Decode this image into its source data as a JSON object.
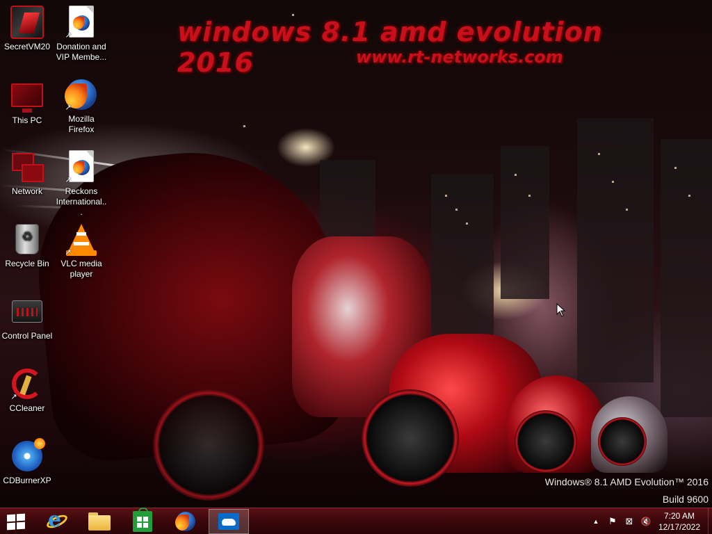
{
  "wallpaper": {
    "title": "windows 8.1 amd evolution 2016",
    "url": "www.rt-networks.com",
    "watermark_line1": "Windows® 8.1 AMD Evolution™ 2016",
    "watermark_line2": "Build 9600",
    "accent_color": "#c8101c"
  },
  "desktop": {
    "icons": [
      {
        "label": "SecretVM20",
        "icon": "secretvm-icon",
        "shortcut": false
      },
      {
        "label": "Donation and VIP Membe...",
        "icon": "firefox-document-icon",
        "shortcut": true
      },
      {
        "label": "This PC",
        "icon": "computer-icon",
        "shortcut": false
      },
      {
        "label": "Mozilla Firefox",
        "icon": "firefox-icon",
        "shortcut": true
      },
      {
        "label": "Network",
        "icon": "network-icon",
        "shortcut": false
      },
      {
        "label": "Reckons International...",
        "icon": "firefox-document-icon",
        "shortcut": true
      },
      {
        "label": "Recycle Bin",
        "icon": "recycle-bin-icon",
        "shortcut": false
      },
      {
        "label": "VLC media player",
        "icon": "vlc-icon",
        "shortcut": true
      },
      {
        "label": "Control Panel",
        "icon": "control-panel-icon",
        "shortcut": false
      },
      {
        "label": "CCleaner",
        "icon": "ccleaner-icon",
        "shortcut": true
      },
      {
        "label": "CDBurnerXP",
        "icon": "cdburnerxp-icon",
        "shortcut": true
      }
    ]
  },
  "taskbar": {
    "color": "#3a070a",
    "pinned": [
      {
        "name": "start",
        "icon": "windows-logo-icon"
      },
      {
        "name": "internet-explorer",
        "icon": "internet-explorer-icon"
      },
      {
        "name": "file-explorer",
        "icon": "folder-icon"
      },
      {
        "name": "store",
        "icon": "store-icon"
      },
      {
        "name": "firefox",
        "icon": "firefox-icon"
      },
      {
        "name": "onedrive",
        "icon": "onedrive-icon",
        "active": true
      }
    ],
    "tray": {
      "icons": [
        "chevron-up-icon",
        "action-center-flag-icon",
        "network-error-icon",
        "volume-muted-icon"
      ],
      "chevron": "▲",
      "flag": "⚑",
      "network": "⊠",
      "volume": "🔇"
    },
    "clock": {
      "time": "7:20 AM",
      "date": "12/17/2022"
    }
  }
}
